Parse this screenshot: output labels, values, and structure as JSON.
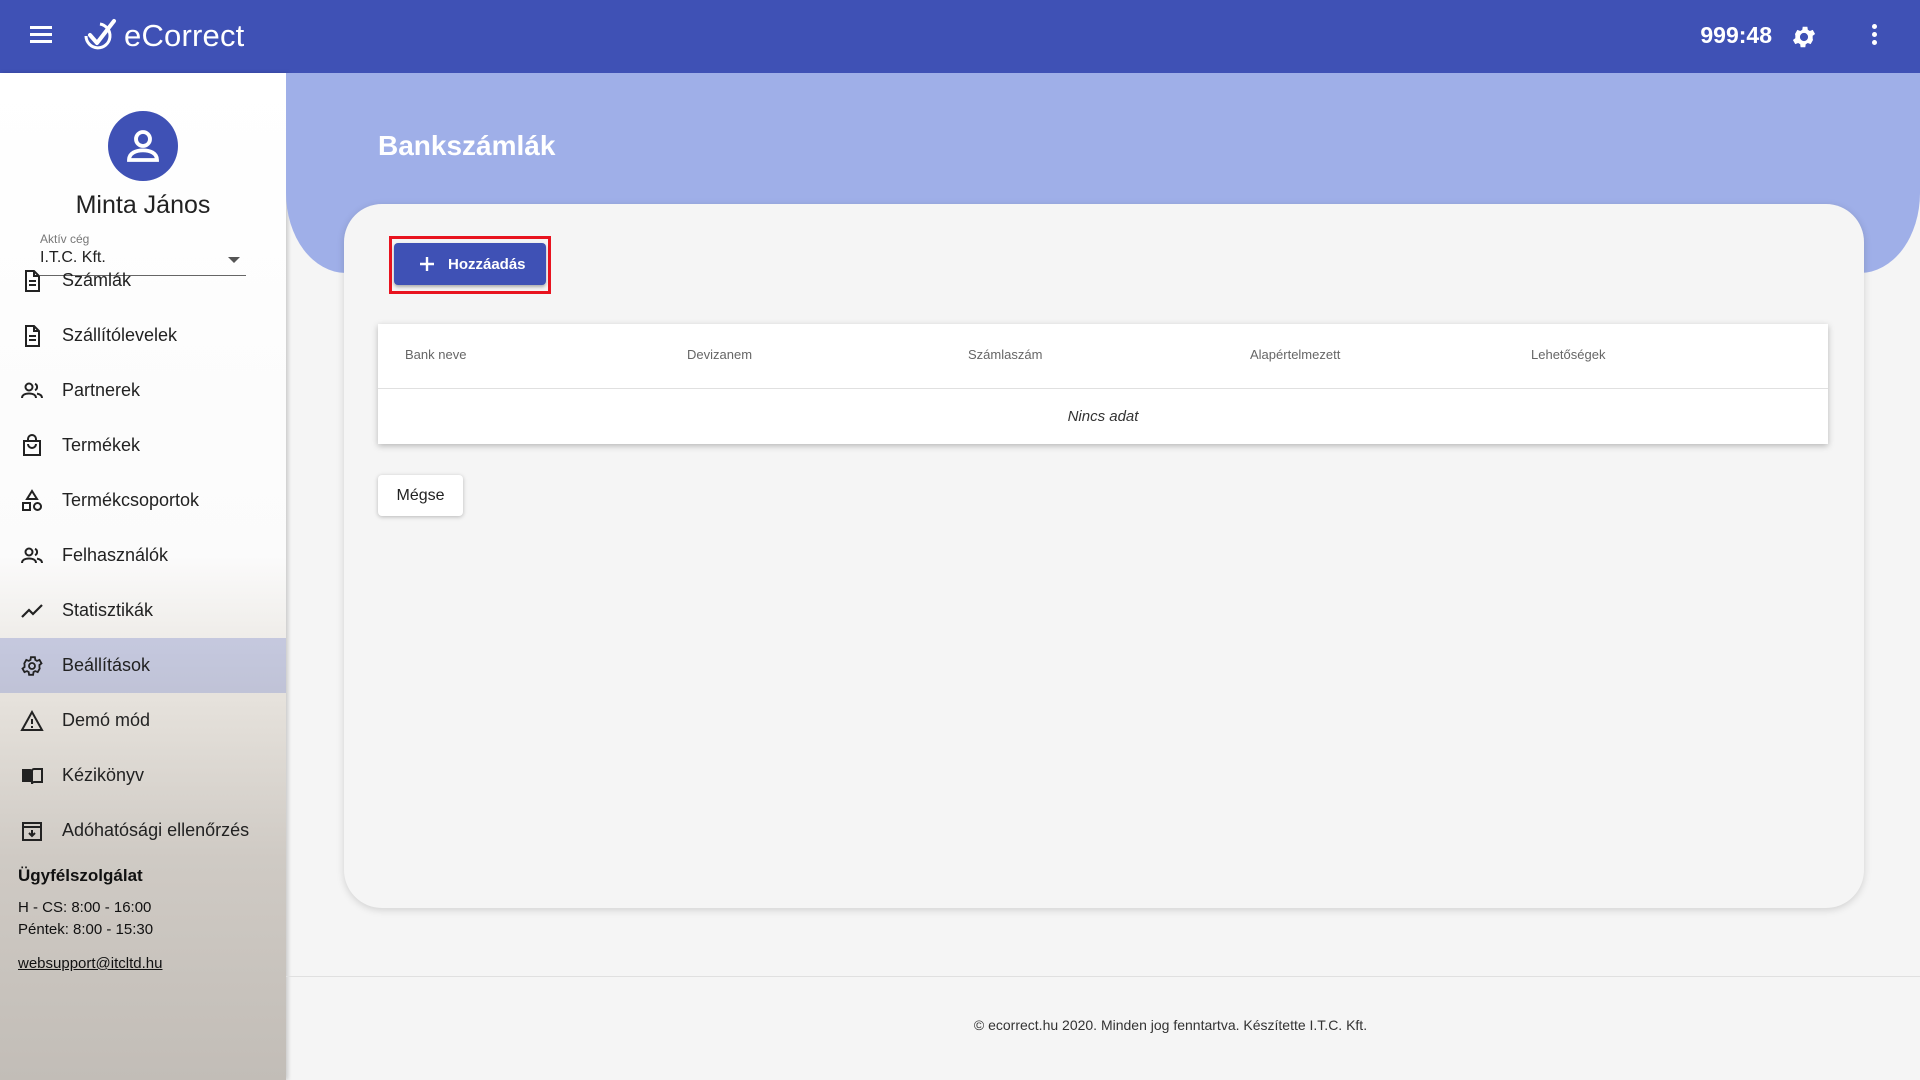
{
  "topbar": {
    "brand": "eCorrect",
    "timer": "999:48",
    "icons": {
      "menu": "menu-icon",
      "settings": "gear-icon",
      "more": "more-vertical-icon"
    },
    "color": "#3f51b5"
  },
  "sidebar": {
    "user_name": "Minta János",
    "company_label": "Aktív cég",
    "company_value": "I.T.C. Kft.",
    "items": [
      {
        "label": "Számlák",
        "icon": "document-icon"
      },
      {
        "label": "Szállítólevelek",
        "icon": "document-icon"
      },
      {
        "label": "Partnerek",
        "icon": "people-icon"
      },
      {
        "label": "Termékek",
        "icon": "shopping-bag-icon"
      },
      {
        "label": "Termékcsoportok",
        "icon": "shapes-icon"
      },
      {
        "label": "Felhasználók",
        "icon": "people-icon"
      },
      {
        "label": "Statisztikák",
        "icon": "trend-line-icon"
      },
      {
        "label": "Beállítások",
        "icon": "gear-icon",
        "active": true
      },
      {
        "label": "Demó mód",
        "icon": "warning-icon"
      },
      {
        "label": "Kézikönyv",
        "icon": "book-icon"
      },
      {
        "label": "Adóhatósági ellenőrzés",
        "icon": "archive-download-icon"
      }
    ],
    "support": {
      "title": "Ügyfélszolgálat",
      "hours_weekdays": "H - CS: 8:00 - 16:00",
      "hours_friday": "Péntek: 8:00 - 15:30",
      "email": "websupport@itcltd.hu"
    }
  },
  "main": {
    "title": "Bankszámlák",
    "add_button": "Hozzáadás",
    "table": {
      "columns": [
        "Bank neve",
        "Devizanem",
        "Számlaszám",
        "Alapértelmezett",
        "Lehetőségek"
      ],
      "empty_text": "Nincs adat"
    },
    "cancel_button": "Mégse"
  },
  "footer": {
    "text": "© ecorrect.hu 2020. Minden jog fenntartva. Készítette I.T.C. Kft."
  }
}
